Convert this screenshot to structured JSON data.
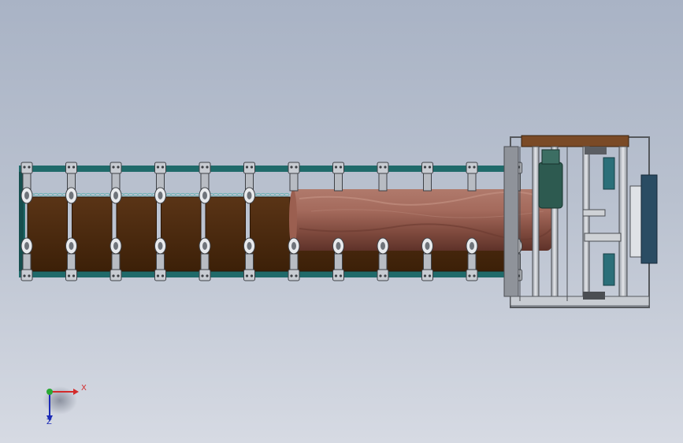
{
  "triad": {
    "x_label": "X",
    "z_label": "Z",
    "x_color": "#d32b2b",
    "y_color": "#2aa835",
    "z_color": "#1c2bb6"
  },
  "colors": {
    "background_top": "#a9b3c5",
    "background_bottom": "#d6dae3",
    "frame_teal": "#1f6a6a",
    "panel_brown": "#4a2a10",
    "roller_copper": "#8e5244",
    "bracket_grey": "#c8ccd2",
    "head_frame_grey": "#b9bcc2"
  },
  "scene": {
    "description_icon": "conveyor-cad-model-icon",
    "bracket_count": 12,
    "panel_count": 11
  }
}
